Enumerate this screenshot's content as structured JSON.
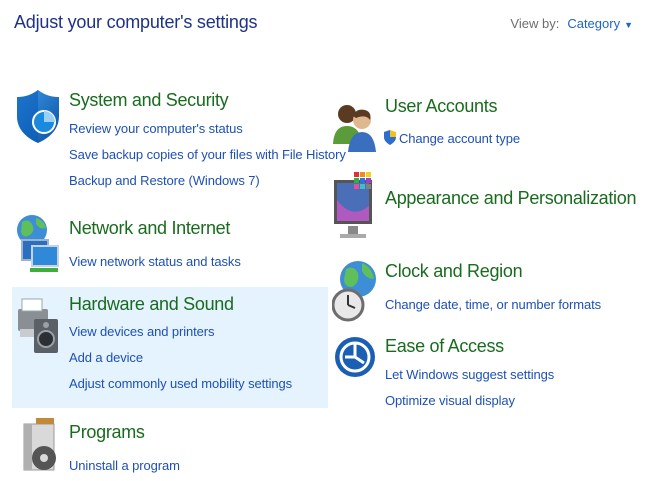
{
  "header": {
    "title": "Adjust your computer's settings",
    "view_by_label": "View by:",
    "view_by_value": "Category"
  },
  "categories": [
    {
      "title": "System and Security",
      "links": [
        "Review your computer's status",
        "Save backup copies of your files with File History",
        "Backup and Restore (Windows 7)"
      ],
      "icon": "shield-icon"
    },
    {
      "title": "Network and Internet",
      "links": [
        "View network status and tasks"
      ],
      "icon": "globe-network-icon"
    },
    {
      "title": "Hardware and Sound",
      "links": [
        "View devices and printers",
        "Add a device",
        "Adjust commonly used mobility settings"
      ],
      "icon": "printer-speaker-icon",
      "highlighted": true
    },
    {
      "title": "Programs",
      "links": [
        "Uninstall a program"
      ],
      "icon": "programs-disc-icon"
    },
    {
      "title": "User Accounts",
      "links": [
        "Change account type"
      ],
      "icon": "users-icon",
      "link_icon": "uac-shield-icon"
    },
    {
      "title": "Appearance and Personalization",
      "links": [],
      "icon": "monitor-palette-icon"
    },
    {
      "title": "Clock and Region",
      "links": [
        "Change date, time, or number formats"
      ],
      "icon": "clock-globe-icon"
    },
    {
      "title": "Ease of Access",
      "links": [
        "Let Windows suggest settings",
        "Optimize visual display"
      ],
      "icon": "ease-of-access-icon"
    }
  ],
  "colors": {
    "title": "#1e3287",
    "category_title": "#196b1e",
    "link": "#1e50b4",
    "hover_bg": "#e5f3ff"
  }
}
